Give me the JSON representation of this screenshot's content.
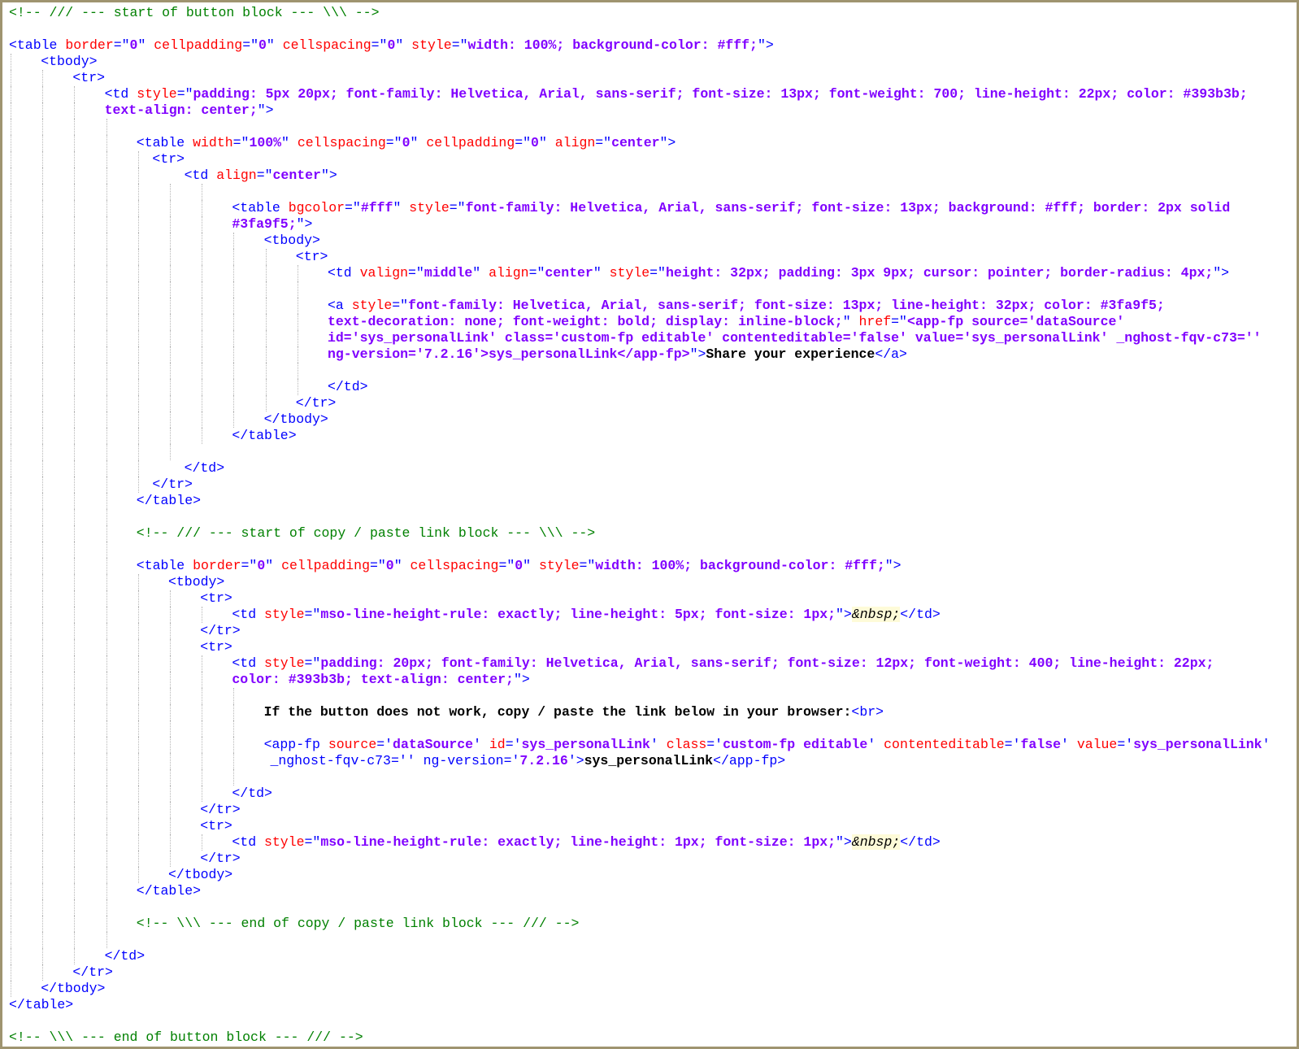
{
  "editor": {
    "code_lines": [
      {
        "guides": 0,
        "indent": 0,
        "seg": [
          {
            "k": "cmt",
            "t": "<!-- /// --- start of button block --- \\\\\\ -->"
          }
        ]
      },
      {
        "guides": 0,
        "indent": 0,
        "seg": []
      },
      {
        "guides": 0,
        "indent": 0,
        "seg": [
          {
            "k": "tag",
            "t": "<table "
          },
          {
            "k": "attr",
            "t": "border"
          },
          {
            "k": "tag",
            "t": "=\""
          },
          {
            "k": "val",
            "t": "0"
          },
          {
            "k": "tag",
            "t": "\" "
          },
          {
            "k": "attr",
            "t": "cellpadding"
          },
          {
            "k": "tag",
            "t": "=\""
          },
          {
            "k": "val",
            "t": "0"
          },
          {
            "k": "tag",
            "t": "\" "
          },
          {
            "k": "attr",
            "t": "cellspacing"
          },
          {
            "k": "tag",
            "t": "=\""
          },
          {
            "k": "val",
            "t": "0"
          },
          {
            "k": "tag",
            "t": "\" "
          },
          {
            "k": "attr",
            "t": "style"
          },
          {
            "k": "tag",
            "t": "=\""
          },
          {
            "k": "val",
            "t": "width: 100%; background-color: #fff;"
          },
          {
            "k": "tag",
            "t": "\">"
          }
        ]
      },
      {
        "guides": 1,
        "indent": 1,
        "seg": [
          {
            "k": "tag",
            "t": "<tbody>"
          }
        ]
      },
      {
        "guides": 2,
        "indent": 2,
        "seg": [
          {
            "k": "tag",
            "t": "<tr>"
          }
        ]
      },
      {
        "guides": 3,
        "indent": 3,
        "seg": [
          {
            "k": "tag",
            "t": "<td "
          },
          {
            "k": "attr",
            "t": "style"
          },
          {
            "k": "tag",
            "t": "=\""
          },
          {
            "k": "val",
            "t": "padding: 5px 20px; font-family: Helvetica, Arial, sans-serif; font-size: 13px; font-weight: 700; line-height: 22px; color: #393b3b;"
          }
        ]
      },
      {
        "guides": 3,
        "indent": 3,
        "seg": [
          {
            "k": "val",
            "t": "text-align: center;"
          },
          {
            "k": "tag",
            "t": "\">"
          }
        ]
      },
      {
        "guides": 4,
        "indent": 4,
        "seg": []
      },
      {
        "guides": 4,
        "indent": 4,
        "seg": [
          {
            "k": "tag",
            "t": "<table "
          },
          {
            "k": "attr",
            "t": "width"
          },
          {
            "k": "tag",
            "t": "=\""
          },
          {
            "k": "val",
            "t": "100%"
          },
          {
            "k": "tag",
            "t": "\" "
          },
          {
            "k": "attr",
            "t": "cellspacing"
          },
          {
            "k": "tag",
            "t": "=\""
          },
          {
            "k": "val",
            "t": "0"
          },
          {
            "k": "tag",
            "t": "\" "
          },
          {
            "k": "attr",
            "t": "cellpadding"
          },
          {
            "k": "tag",
            "t": "=\""
          },
          {
            "k": "val",
            "t": "0"
          },
          {
            "k": "tag",
            "t": "\" "
          },
          {
            "k": "attr",
            "t": "align"
          },
          {
            "k": "tag",
            "t": "=\""
          },
          {
            "k": "val",
            "t": "center"
          },
          {
            "k": "tag",
            "t": "\">"
          }
        ]
      },
      {
        "guides": 5,
        "indent": 4.5,
        "seg": [
          {
            "k": "tag",
            "t": "<tr>"
          }
        ]
      },
      {
        "guides": 5,
        "indent": 5.5,
        "seg": [
          {
            "k": "tag",
            "t": "<td "
          },
          {
            "k": "attr",
            "t": "align"
          },
          {
            "k": "tag",
            "t": "=\""
          },
          {
            "k": "val",
            "t": "center"
          },
          {
            "k": "tag",
            "t": "\">"
          }
        ]
      },
      {
        "guides": 7,
        "indent": 7,
        "seg": []
      },
      {
        "guides": 7,
        "indent": 7,
        "seg": [
          {
            "k": "tag",
            "t": "<table "
          },
          {
            "k": "attr",
            "t": "bgcolor"
          },
          {
            "k": "tag",
            "t": "=\""
          },
          {
            "k": "val",
            "t": "#fff"
          },
          {
            "k": "tag",
            "t": "\" "
          },
          {
            "k": "attr",
            "t": "style"
          },
          {
            "k": "tag",
            "t": "=\""
          },
          {
            "k": "val",
            "t": "font-family: Helvetica, Arial, sans-serif; font-size: 13px; background: #fff; border: 2px solid"
          }
        ]
      },
      {
        "guides": 7,
        "indent": 7,
        "seg": [
          {
            "k": "val",
            "t": "#3fa9f5;"
          },
          {
            "k": "tag",
            "t": "\">"
          }
        ]
      },
      {
        "guides": 8,
        "indent": 8,
        "seg": [
          {
            "k": "tag",
            "t": "<tbody>"
          }
        ]
      },
      {
        "guides": 9,
        "indent": 9,
        "seg": [
          {
            "k": "tag",
            "t": "<tr>"
          }
        ]
      },
      {
        "guides": 10,
        "indent": 10,
        "seg": [
          {
            "k": "tag",
            "t": "<td "
          },
          {
            "k": "attr",
            "t": "valign"
          },
          {
            "k": "tag",
            "t": "=\""
          },
          {
            "k": "val",
            "t": "middle"
          },
          {
            "k": "tag",
            "t": "\" "
          },
          {
            "k": "attr",
            "t": "align"
          },
          {
            "k": "tag",
            "t": "=\""
          },
          {
            "k": "val",
            "t": "center"
          },
          {
            "k": "tag",
            "t": "\" "
          },
          {
            "k": "attr",
            "t": "style"
          },
          {
            "k": "tag",
            "t": "=\""
          },
          {
            "k": "val",
            "t": "height: 32px; padding: 3px 9px; cursor: pointer; border-radius: 4px;"
          },
          {
            "k": "tag",
            "t": "\">"
          }
        ]
      },
      {
        "guides": 10,
        "indent": 10,
        "seg": []
      },
      {
        "guides": 10,
        "indent": 10,
        "seg": [
          {
            "k": "tag",
            "t": "<a "
          },
          {
            "k": "attr",
            "t": "style"
          },
          {
            "k": "tag",
            "t": "=\""
          },
          {
            "k": "val",
            "t": "font-family: Helvetica, Arial, sans-serif; font-size: 13px; line-height: 32px; color: #3fa9f5;"
          }
        ]
      },
      {
        "guides": 10,
        "indent": 10,
        "seg": [
          {
            "k": "val",
            "t": "text-decoration: none; font-weight: bold; display: inline-block;"
          },
          {
            "k": "tag",
            "t": "\" "
          },
          {
            "k": "attr",
            "t": "href"
          },
          {
            "k": "tag",
            "t": "=\""
          },
          {
            "k": "val",
            "t": "<app-fp source='dataSource'"
          }
        ]
      },
      {
        "guides": 10,
        "indent": 10,
        "seg": [
          {
            "k": "val",
            "t": "id='sys_personalLink' class='custom-fp editable' contenteditable='false' value='sys_personalLink' _nghost-fqv-c73=''"
          }
        ]
      },
      {
        "guides": 10,
        "indent": 10,
        "seg": [
          {
            "k": "val",
            "t": "ng-version='7.2.16'>sys_personalLink</app-fp>"
          },
          {
            "k": "tag",
            "t": "\">"
          },
          {
            "k": "txt",
            "t": "Share your experience"
          },
          {
            "k": "tag",
            "t": "</a>"
          }
        ]
      },
      {
        "guides": 10,
        "indent": 10,
        "seg": []
      },
      {
        "guides": 10,
        "indent": 10,
        "seg": [
          {
            "k": "tag",
            "t": "</td>"
          }
        ]
      },
      {
        "guides": 9,
        "indent": 9,
        "seg": [
          {
            "k": "tag",
            "t": "</tr>"
          }
        ]
      },
      {
        "guides": 8,
        "indent": 8,
        "seg": [
          {
            "k": "tag",
            "t": "</tbody>"
          }
        ]
      },
      {
        "guides": 7,
        "indent": 7,
        "seg": [
          {
            "k": "tag",
            "t": "</table>"
          }
        ]
      },
      {
        "guides": 6,
        "indent": 6,
        "seg": []
      },
      {
        "guides": 5,
        "indent": 5.5,
        "seg": [
          {
            "k": "tag",
            "t": "</td>"
          }
        ]
      },
      {
        "guides": 5,
        "indent": 4.5,
        "seg": [
          {
            "k": "tag",
            "t": "</tr>"
          }
        ]
      },
      {
        "guides": 4,
        "indent": 4,
        "seg": [
          {
            "k": "tag",
            "t": "</table>"
          }
        ]
      },
      {
        "guides": 4,
        "indent": 4,
        "seg": []
      },
      {
        "guides": 4,
        "indent": 4,
        "seg": [
          {
            "k": "cmt",
            "t": "<!-- /// --- start of copy / paste link block --- \\\\\\ -->"
          }
        ]
      },
      {
        "guides": 4,
        "indent": 4,
        "seg": []
      },
      {
        "guides": 4,
        "indent": 4,
        "seg": [
          {
            "k": "tag",
            "t": "<table "
          },
          {
            "k": "attr",
            "t": "border"
          },
          {
            "k": "tag",
            "t": "=\""
          },
          {
            "k": "val",
            "t": "0"
          },
          {
            "k": "tag",
            "t": "\" "
          },
          {
            "k": "attr",
            "t": "cellpadding"
          },
          {
            "k": "tag",
            "t": "=\""
          },
          {
            "k": "val",
            "t": "0"
          },
          {
            "k": "tag",
            "t": "\" "
          },
          {
            "k": "attr",
            "t": "cellspacing"
          },
          {
            "k": "tag",
            "t": "=\""
          },
          {
            "k": "val",
            "t": "0"
          },
          {
            "k": "tag",
            "t": "\" "
          },
          {
            "k": "attr",
            "t": "style"
          },
          {
            "k": "tag",
            "t": "=\""
          },
          {
            "k": "val",
            "t": "width: 100%; background-color: #fff;"
          },
          {
            "k": "tag",
            "t": "\">"
          }
        ]
      },
      {
        "guides": 5,
        "indent": 5,
        "seg": [
          {
            "k": "tag",
            "t": "<tbody>"
          }
        ]
      },
      {
        "guides": 6,
        "indent": 6,
        "seg": [
          {
            "k": "tag",
            "t": "<tr>"
          }
        ]
      },
      {
        "guides": 7,
        "indent": 7,
        "seg": [
          {
            "k": "tag",
            "t": "<td "
          },
          {
            "k": "attr",
            "t": "style"
          },
          {
            "k": "tag",
            "t": "=\""
          },
          {
            "k": "val",
            "t": "mso-line-height-rule: exactly; line-height: 5px; font-size: 1px;"
          },
          {
            "k": "tag",
            "t": "\">"
          },
          {
            "k": "ent",
            "t": "&nbsp;"
          },
          {
            "k": "tag",
            "t": "</td>"
          }
        ]
      },
      {
        "guides": 6,
        "indent": 6,
        "seg": [
          {
            "k": "tag",
            "t": "</tr>"
          }
        ]
      },
      {
        "guides": 6,
        "indent": 6,
        "seg": [
          {
            "k": "tag",
            "t": "<tr>"
          }
        ]
      },
      {
        "guides": 7,
        "indent": 7,
        "seg": [
          {
            "k": "tag",
            "t": "<td "
          },
          {
            "k": "attr",
            "t": "style"
          },
          {
            "k": "tag",
            "t": "=\""
          },
          {
            "k": "val",
            "t": "padding: 20px; font-family: Helvetica, Arial, sans-serif; font-size: 12px; font-weight: 400; line-height: 22px;"
          }
        ]
      },
      {
        "guides": 7,
        "indent": 7,
        "seg": [
          {
            "k": "val",
            "t": "color: #393b3b; text-align: center;"
          },
          {
            "k": "tag",
            "t": "\">"
          }
        ]
      },
      {
        "guides": 8,
        "indent": 8,
        "seg": []
      },
      {
        "guides": 8,
        "indent": 8,
        "seg": [
          {
            "k": "txt",
            "t": "If the button does not work, copy / paste the link below in your browser:"
          },
          {
            "k": "tag",
            "t": "<br>"
          }
        ]
      },
      {
        "guides": 8,
        "indent": 8,
        "seg": []
      },
      {
        "guides": 8,
        "indent": 8,
        "seg": [
          {
            "k": "tag",
            "t": "<app-fp "
          },
          {
            "k": "attr",
            "t": "source"
          },
          {
            "k": "tag",
            "t": "='"
          },
          {
            "k": "val",
            "t": "dataSource"
          },
          {
            "k": "tag",
            "t": "' "
          },
          {
            "k": "attr",
            "t": "id"
          },
          {
            "k": "tag",
            "t": "='"
          },
          {
            "k": "val",
            "t": "sys_personalLink"
          },
          {
            "k": "tag",
            "t": "' "
          },
          {
            "k": "attr",
            "t": "class"
          },
          {
            "k": "tag",
            "t": "='"
          },
          {
            "k": "val",
            "t": "custom-fp editable"
          },
          {
            "k": "tag",
            "t": "' "
          },
          {
            "k": "attr",
            "t": "contenteditable"
          },
          {
            "k": "tag",
            "t": "='"
          },
          {
            "k": "val",
            "t": "false"
          },
          {
            "k": "tag",
            "t": "' "
          },
          {
            "k": "attr",
            "t": "value"
          },
          {
            "k": "tag",
            "t": "='"
          },
          {
            "k": "val",
            "t": "sys_personalLink"
          },
          {
            "k": "tag",
            "t": "'"
          }
        ]
      },
      {
        "guides": 8,
        "indent": 8.2,
        "seg": [
          {
            "k": "tag",
            "t": "_nghost-fqv-c73='' ng-version='"
          },
          {
            "k": "val",
            "t": "7.2.16"
          },
          {
            "k": "tag",
            "t": "'>"
          },
          {
            "k": "txt",
            "t": "sys_personalLink"
          },
          {
            "k": "tag",
            "t": "</app-fp>"
          }
        ]
      },
      {
        "guides": 8,
        "indent": 8,
        "seg": []
      },
      {
        "guides": 7,
        "indent": 7,
        "seg": [
          {
            "k": "tag",
            "t": "</td>"
          }
        ]
      },
      {
        "guides": 6,
        "indent": 6,
        "seg": [
          {
            "k": "tag",
            "t": "</tr>"
          }
        ]
      },
      {
        "guides": 6,
        "indent": 6,
        "seg": [
          {
            "k": "tag",
            "t": "<tr>"
          }
        ]
      },
      {
        "guides": 7,
        "indent": 7,
        "seg": [
          {
            "k": "tag",
            "t": "<td "
          },
          {
            "k": "attr",
            "t": "style"
          },
          {
            "k": "tag",
            "t": "=\""
          },
          {
            "k": "val",
            "t": "mso-line-height-rule: exactly; line-height: 1px; font-size: 1px;"
          },
          {
            "k": "tag",
            "t": "\">"
          },
          {
            "k": "ent",
            "t": "&nbsp;"
          },
          {
            "k": "tag",
            "t": "</td>"
          }
        ]
      },
      {
        "guides": 6,
        "indent": 6,
        "seg": [
          {
            "k": "tag",
            "t": "</tr>"
          }
        ]
      },
      {
        "guides": 5,
        "indent": 5,
        "seg": [
          {
            "k": "tag",
            "t": "</tbody>"
          }
        ]
      },
      {
        "guides": 4,
        "indent": 4,
        "seg": [
          {
            "k": "tag",
            "t": "</table>"
          }
        ]
      },
      {
        "guides": 4,
        "indent": 4,
        "seg": []
      },
      {
        "guides": 4,
        "indent": 4,
        "seg": [
          {
            "k": "cmt",
            "t": "<!-- \\\\\\ --- end of copy / paste link block --- /// -->"
          }
        ]
      },
      {
        "guides": 4,
        "indent": 4,
        "seg": []
      },
      {
        "guides": 3,
        "indent": 3,
        "seg": [
          {
            "k": "tag",
            "t": "</td>"
          }
        ]
      },
      {
        "guides": 2,
        "indent": 2,
        "seg": [
          {
            "k": "tag",
            "t": "</tr>"
          }
        ]
      },
      {
        "guides": 1,
        "indent": 1,
        "seg": [
          {
            "k": "tag",
            "t": "</tbody>"
          }
        ]
      },
      {
        "guides": 0,
        "indent": 0,
        "seg": [
          {
            "k": "tag",
            "t": "</table>"
          }
        ]
      },
      {
        "guides": 0,
        "indent": 0,
        "seg": []
      },
      {
        "guides": 0,
        "indent": 0,
        "seg": [
          {
            "k": "cmt",
            "t": "<!-- \\\\\\ --- end of button block --- /// -->"
          }
        ]
      }
    ]
  }
}
